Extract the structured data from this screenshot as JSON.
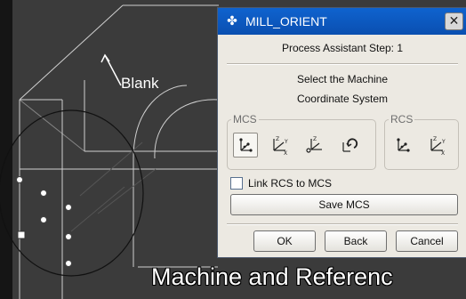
{
  "viewport": {
    "blank_label": "Blank",
    "caption": "Machine and Referenc"
  },
  "dialog": {
    "title": "MILL_ORIENT",
    "close_glyph": "✕",
    "step_text": "Process Assistant Step: 1",
    "instruction_line1": "Select the Machine",
    "instruction_line2": "Coordinate System",
    "mcs_group": {
      "legend": "MCS",
      "tools": [
        "mcs-csys-dialog-icon",
        "mcs-axes-icon",
        "mcs-origin-icon",
        "mcs-rotate-icon"
      ],
      "selected_index": 0
    },
    "rcs_group": {
      "legend": "RCS",
      "tools": [
        "rcs-csys-dialog-icon",
        "rcs-axes-icon"
      ]
    },
    "link_checkbox": {
      "label": "Link RCS to MCS",
      "checked": false
    },
    "save_label": "Save MCS",
    "ok_label": "OK",
    "back_label": "Back",
    "cancel_label": "Cancel"
  },
  "colors": {
    "titlebar": "#0a5ad0",
    "dialog_bg": "#ece9e2",
    "viewport_bg": "#3a3a3a"
  }
}
